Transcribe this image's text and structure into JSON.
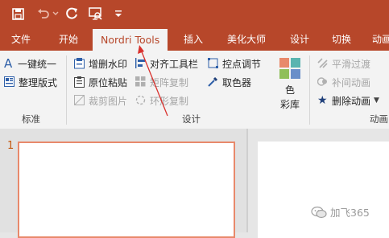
{
  "colors": {
    "accent": "#b7472a",
    "ribbon_bg": "#f3f3f3",
    "arrow": "#d9302c"
  },
  "quick_access": {
    "save_icon": "save-icon",
    "undo_icon": "undo-icon",
    "redo_icon": "redo-icon",
    "present_icon": "present-icon",
    "customize_icon": "dropdown-icon"
  },
  "tabs": [
    {
      "label": "文件"
    },
    {
      "label": "开始"
    },
    {
      "label": "Nordri Tools",
      "active": true
    },
    {
      "label": "插入"
    },
    {
      "label": "美化大师"
    },
    {
      "label": "设计"
    },
    {
      "label": "切换"
    },
    {
      "label": "动画"
    }
  ],
  "ribbon": {
    "group_standard": {
      "label": "标准",
      "items": [
        {
          "label": "一键统一",
          "icon": "letter-a-icon"
        },
        {
          "label": "整理版式",
          "icon": "layout-icon"
        }
      ]
    },
    "group_design": {
      "label": "设计",
      "col1": [
        {
          "label": "增删水印",
          "icon": "watermark-icon",
          "enabled": true
        },
        {
          "label": "原位粘贴",
          "icon": "paste-icon",
          "enabled": true
        },
        {
          "label": "裁剪图片",
          "icon": "crop-icon",
          "enabled": false
        }
      ],
      "col2": [
        {
          "label": "对齐工具栏",
          "icon": "align-icon",
          "enabled": true
        },
        {
          "label": "矩阵复制",
          "icon": "matrix-icon",
          "enabled": false
        },
        {
          "label": "环形复制",
          "icon": "ring-icon",
          "enabled": false
        }
      ],
      "col3": [
        {
          "label": "控点调节",
          "icon": "handle-icon",
          "enabled": true
        },
        {
          "label": "取色器",
          "icon": "eyedropper-icon",
          "enabled": true
        }
      ],
      "color_library": {
        "line1": "色",
        "line2": "彩库",
        "icon": "color-palette-icon"
      }
    },
    "group_animation": {
      "label": "动画",
      "items": [
        {
          "label": "平滑过渡",
          "icon": "smooth-transition-icon",
          "enabled": false
        },
        {
          "label": "补间动画",
          "icon": "tween-icon",
          "enabled": false
        },
        {
          "label": "删除动画",
          "icon": "star-icon",
          "enabled": true
        }
      ]
    }
  },
  "thumbnails": {
    "slide_number": "1"
  },
  "watermark": {
    "text": "加飞365",
    "icon": "wechat-icon"
  }
}
